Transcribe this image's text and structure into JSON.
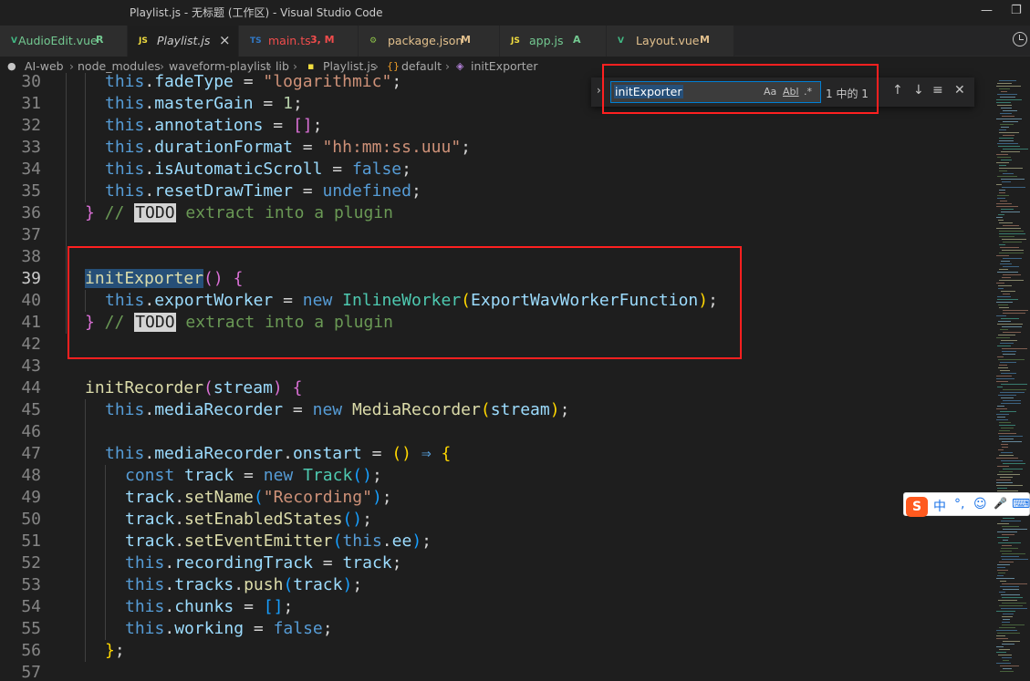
{
  "window": {
    "title": "Playlist.js - 无标题 (工作区) - Visual Studio Code",
    "minimize_glyph": "—",
    "restore_glyph": "❐"
  },
  "tabs": [
    {
      "icon": "vue-icon",
      "icon_glyph": "V",
      "label": "AudioEdit.vue",
      "badge": "R",
      "color": "#73c991"
    },
    {
      "icon": "javascript-icon",
      "icon_glyph": "JS",
      "label": "Playlist.js",
      "badge": "",
      "close": "×",
      "active": true
    },
    {
      "icon": "typescript-icon",
      "icon_glyph": "TS",
      "label": "main.ts",
      "badge": "3, M",
      "color": "#f14c4c"
    },
    {
      "icon": "npm-package-icon",
      "icon_glyph": "⚙",
      "label": "package.json",
      "badge": "M",
      "color": "#e2c08d"
    },
    {
      "icon": "javascript-icon",
      "icon_glyph": "JS",
      "label": "app.js",
      "badge": "A",
      "color": "#73c991"
    },
    {
      "icon": "vue-icon",
      "icon_glyph": "V",
      "label": "Layout.vue",
      "badge": "M",
      "color": "#e2c08d"
    }
  ],
  "breadcrumb": {
    "items": [
      "AI-web",
      "node_modules",
      "waveform-playlist",
      "lib",
      "Playlist.js",
      "default",
      "initExporter"
    ],
    "separator": "›"
  },
  "find": {
    "query": "initExporter",
    "match_case": "Aa",
    "whole_word": "Abl",
    "regex": ".*",
    "result_count": "1 中的 1",
    "prev": "↑",
    "next": "↓",
    "in_selection": "≡",
    "close": "✕",
    "toggle_replace": "›"
  },
  "ime": {
    "logo": "S",
    "items": [
      "中",
      "°,",
      "☺",
      "🎤",
      "⌨"
    ]
  },
  "editor": {
    "lines": [
      {
        "n": "30",
        "tokens": [
          [
            "kw-this",
            "this"
          ],
          [
            "op",
            "."
          ],
          [
            "prop",
            "fadeType"
          ],
          [
            "op",
            " = "
          ],
          [
            "str",
            "\"logarithmic\""
          ],
          [
            "op",
            ";"
          ]
        ],
        "indent": 115
      },
      {
        "n": "31",
        "tokens": [
          [
            "kw-this",
            "this"
          ],
          [
            "op",
            "."
          ],
          [
            "prop",
            "masterGain"
          ],
          [
            "op",
            " = "
          ],
          [
            "num",
            "1"
          ],
          [
            "op",
            ";"
          ]
        ],
        "indent": 115
      },
      {
        "n": "32",
        "tokens": [
          [
            "kw-this",
            "this"
          ],
          [
            "op",
            "."
          ],
          [
            "prop",
            "annotations"
          ],
          [
            "op",
            " = "
          ],
          [
            "brace1",
            "[]"
          ],
          [
            "op",
            ";"
          ]
        ],
        "indent": 115
      },
      {
        "n": "33",
        "tokens": [
          [
            "kw-this",
            "this"
          ],
          [
            "op",
            "."
          ],
          [
            "prop",
            "durationFormat"
          ],
          [
            "op",
            " = "
          ],
          [
            "str",
            "\"hh:mm:ss.uuu\""
          ],
          [
            "op",
            ";"
          ]
        ],
        "indent": 115
      },
      {
        "n": "34",
        "tokens": [
          [
            "kw-this",
            "this"
          ],
          [
            "op",
            "."
          ],
          [
            "prop",
            "isAutomaticScroll"
          ],
          [
            "op",
            " = "
          ],
          [
            "bool",
            "false"
          ],
          [
            "op",
            ";"
          ]
        ],
        "indent": 115
      },
      {
        "n": "35",
        "tokens": [
          [
            "kw-this",
            "this"
          ],
          [
            "op",
            "."
          ],
          [
            "prop",
            "resetDrawTimer"
          ],
          [
            "op",
            " = "
          ],
          [
            "bool",
            "undefined"
          ],
          [
            "op",
            ";"
          ]
        ],
        "indent": 115
      },
      {
        "n": "36",
        "tokens": [
          [
            "brace1",
            "}"
          ],
          [
            "cmt",
            " // "
          ],
          [
            "todo",
            "TODO"
          ],
          [
            "cmt",
            " extract into a plugin"
          ]
        ],
        "indent": 93
      },
      {
        "n": "37",
        "tokens": [],
        "indent": 93
      },
      {
        "n": "38",
        "tokens": [],
        "indent": 93
      },
      {
        "n": "39",
        "tokens": [
          [
            "fn hl-word",
            "initExporter"
          ],
          [
            "brace1",
            "()"
          ],
          [
            "op",
            " "
          ],
          [
            "brace1",
            "{"
          ]
        ],
        "indent": 93,
        "current": true
      },
      {
        "n": "40",
        "tokens": [
          [
            "kw-this",
            "this"
          ],
          [
            "op",
            "."
          ],
          [
            "prop",
            "exportWorker"
          ],
          [
            "op",
            " = "
          ],
          [
            "kw-this",
            "new "
          ],
          [
            "cls",
            "InlineWorker"
          ],
          [
            "brace2",
            "("
          ],
          [
            "prop",
            "ExportWavWorkerFunction"
          ],
          [
            "brace2",
            ")"
          ],
          [
            "op",
            ";"
          ]
        ],
        "indent": 115
      },
      {
        "n": "41",
        "tokens": [
          [
            "brace1",
            "}"
          ],
          [
            "cmt",
            " // "
          ],
          [
            "todo",
            "TODO"
          ],
          [
            "cmt",
            " extract into a plugin"
          ]
        ],
        "indent": 93
      },
      {
        "n": "42",
        "tokens": [],
        "indent": 93
      },
      {
        "n": "43",
        "tokens": [],
        "indent": 93
      },
      {
        "n": "44",
        "tokens": [
          [
            "fn",
            "initRecorder"
          ],
          [
            "brace1",
            "("
          ],
          [
            "prop",
            "stream"
          ],
          [
            "brace1",
            ")"
          ],
          [
            "op",
            " "
          ],
          [
            "brace1",
            "{"
          ]
        ],
        "indent": 93
      },
      {
        "n": "45",
        "tokens": [
          [
            "kw-this",
            "this"
          ],
          [
            "op",
            "."
          ],
          [
            "prop",
            "mediaRecorder"
          ],
          [
            "op",
            " = "
          ],
          [
            "kw-this",
            "new "
          ],
          [
            "fn",
            "MediaRecorder"
          ],
          [
            "brace2",
            "("
          ],
          [
            "prop",
            "stream"
          ],
          [
            "brace2",
            ")"
          ],
          [
            "op",
            ";"
          ]
        ],
        "indent": 115
      },
      {
        "n": "46",
        "tokens": [],
        "indent": 115
      },
      {
        "n": "47",
        "tokens": [
          [
            "kw-this",
            "this"
          ],
          [
            "op",
            "."
          ],
          [
            "prop",
            "mediaRecorder"
          ],
          [
            "op",
            "."
          ],
          [
            "prop",
            "onstart"
          ],
          [
            "op",
            " = "
          ],
          [
            "brace2",
            "()"
          ],
          [
            "op",
            " "
          ],
          [
            "kw-this",
            "⇒"
          ],
          [
            "op",
            " "
          ],
          [
            "brace2",
            "{"
          ]
        ],
        "indent": 115
      },
      {
        "n": "48",
        "tokens": [
          [
            "kw-this",
            "const "
          ],
          [
            "prop",
            "track"
          ],
          [
            "op",
            " = "
          ],
          [
            "kw-this",
            "new "
          ],
          [
            "cls",
            "Track"
          ],
          [
            "brace3",
            "()"
          ],
          [
            "op",
            ";"
          ]
        ],
        "indent": 137
      },
      {
        "n": "49",
        "tokens": [
          [
            "prop",
            "track"
          ],
          [
            "op",
            "."
          ],
          [
            "fn",
            "setName"
          ],
          [
            "brace3",
            "("
          ],
          [
            "str",
            "\"Recording\""
          ],
          [
            "brace3",
            ")"
          ],
          [
            "op",
            ";"
          ]
        ],
        "indent": 137
      },
      {
        "n": "50",
        "tokens": [
          [
            "prop",
            "track"
          ],
          [
            "op",
            "."
          ],
          [
            "fn",
            "setEnabledStates"
          ],
          [
            "brace3",
            "()"
          ],
          [
            "op",
            ";"
          ]
        ],
        "indent": 137
      },
      {
        "n": "51",
        "tokens": [
          [
            "prop",
            "track"
          ],
          [
            "op",
            "."
          ],
          [
            "fn",
            "setEventEmitter"
          ],
          [
            "brace3",
            "("
          ],
          [
            "kw-this",
            "this"
          ],
          [
            "op",
            "."
          ],
          [
            "prop",
            "ee"
          ],
          [
            "brace3",
            ")"
          ],
          [
            "op",
            ";"
          ]
        ],
        "indent": 137
      },
      {
        "n": "52",
        "tokens": [
          [
            "kw-this",
            "this"
          ],
          [
            "op",
            "."
          ],
          [
            "prop",
            "recordingTrack"
          ],
          [
            "op",
            " = "
          ],
          [
            "prop",
            "track"
          ],
          [
            "op",
            ";"
          ]
        ],
        "indent": 137
      },
      {
        "n": "53",
        "tokens": [
          [
            "kw-this",
            "this"
          ],
          [
            "op",
            "."
          ],
          [
            "prop",
            "tracks"
          ],
          [
            "op",
            "."
          ],
          [
            "fn",
            "push"
          ],
          [
            "brace3",
            "("
          ],
          [
            "prop",
            "track"
          ],
          [
            "brace3",
            ")"
          ],
          [
            "op",
            ";"
          ]
        ],
        "indent": 137
      },
      {
        "n": "54",
        "tokens": [
          [
            "kw-this",
            "this"
          ],
          [
            "op",
            "."
          ],
          [
            "prop",
            "chunks"
          ],
          [
            "op",
            " = "
          ],
          [
            "brace3",
            "[]"
          ],
          [
            "op",
            ";"
          ]
        ],
        "indent": 137
      },
      {
        "n": "55",
        "tokens": [
          [
            "kw-this",
            "this"
          ],
          [
            "op",
            "."
          ],
          [
            "prop",
            "working"
          ],
          [
            "op",
            " = "
          ],
          [
            "bool",
            "false"
          ],
          [
            "op",
            ";"
          ]
        ],
        "indent": 137
      },
      {
        "n": "56",
        "tokens": [
          [
            "brace2",
            "}"
          ],
          [
            "op",
            ";"
          ]
        ],
        "indent": 115
      },
      {
        "n": "57",
        "tokens": [],
        "indent": 93
      }
    ]
  }
}
